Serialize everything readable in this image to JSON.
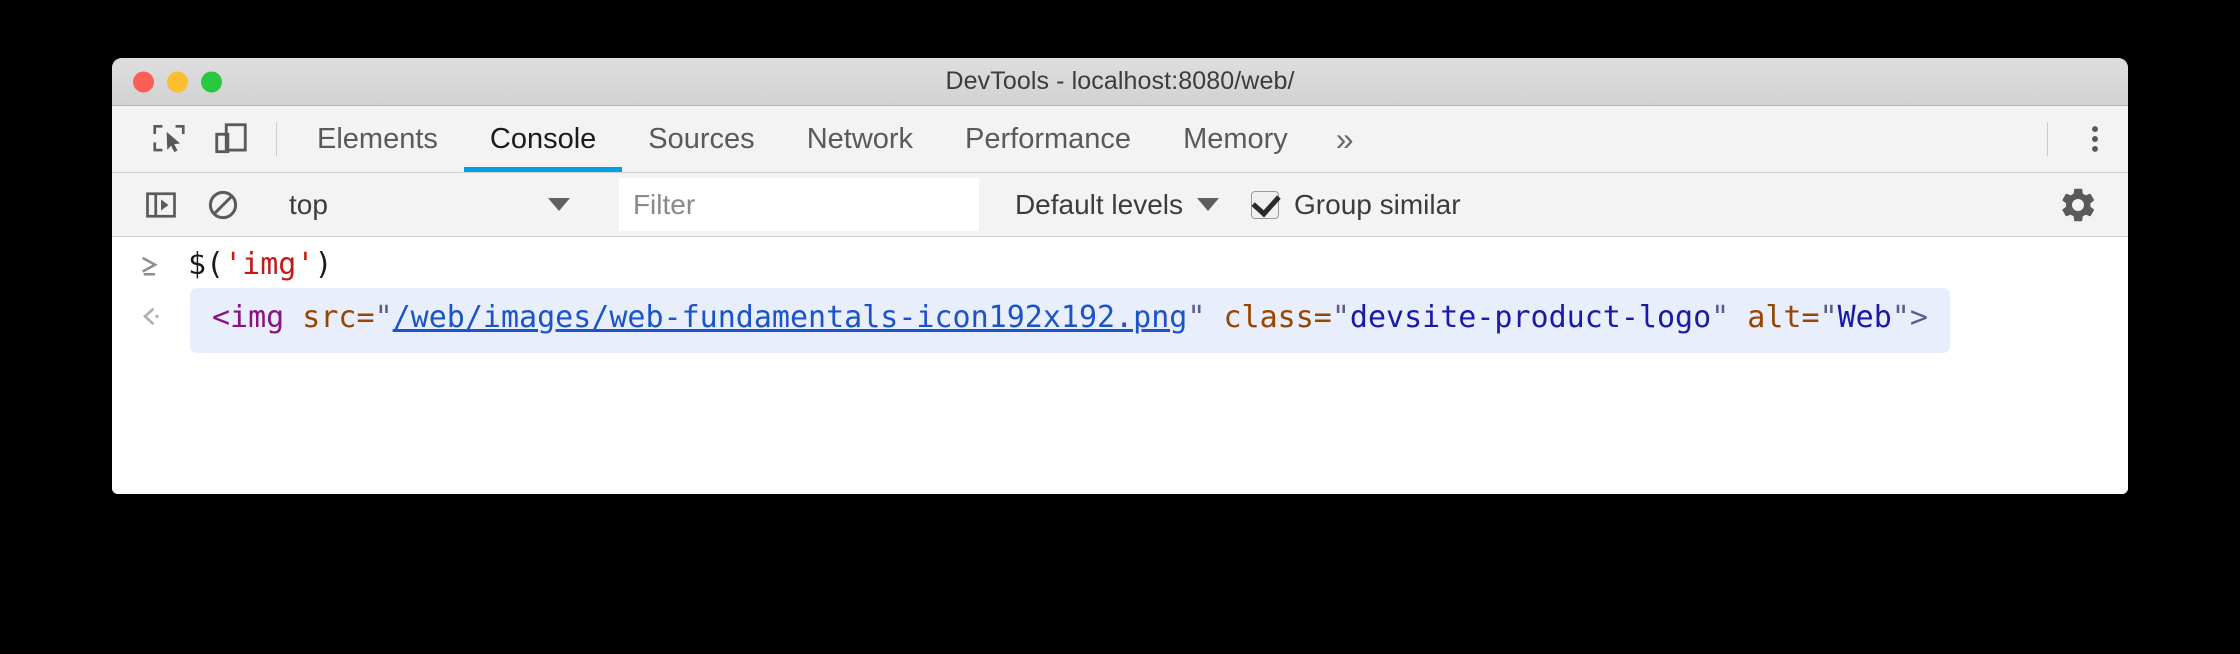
{
  "window": {
    "title": "DevTools - localhost:8080/web/",
    "traffic_lights": [
      "close",
      "minimize",
      "maximize"
    ]
  },
  "colors": {
    "accent": "#00a0e9",
    "titlebar": "#d6d6d6",
    "toolbar": "#f3f3f3",
    "output_highlight": "#e8eefb",
    "link": "#1a54c8",
    "tag": "#881280",
    "attribute": "#994500",
    "value": "#1a1aa6",
    "string": "#c41a16"
  },
  "tabbar": {
    "inspect_icon": "inspect-element-icon",
    "device_icon": "device-toolbar-icon",
    "tabs": [
      {
        "label": "Elements",
        "active": false
      },
      {
        "label": "Console",
        "active": true
      },
      {
        "label": "Sources",
        "active": false
      },
      {
        "label": "Network",
        "active": false
      },
      {
        "label": "Performance",
        "active": false
      },
      {
        "label": "Memory",
        "active": false
      }
    ],
    "more_label": "»",
    "kebab_icon": "more-options-icon"
  },
  "console_toolbar": {
    "sidebar_icon": "console-sidebar-icon",
    "clear_icon": "clear-console-icon",
    "context": "top",
    "context_caret": "▼",
    "filter_placeholder": "Filter",
    "filter_value": "",
    "levels": "Default levels",
    "levels_caret": "▼",
    "group_similar_label": "Group similar",
    "group_similar_checked": true,
    "settings_icon": "settings-gear-icon"
  },
  "console": {
    "input": {
      "prompt": "›",
      "code_prefix": "$(",
      "code_string": "'img'",
      "code_suffix": ")"
    },
    "output": {
      "prompt": "‹",
      "tag_open": "<img",
      "attr_src": " src=",
      "quote": "\"",
      "src_value": "/web/images/web-fundamentals-icon192x192.png",
      "attr_class": " class=",
      "class_value": "devsite-product-logo",
      "attr_alt": " alt=",
      "alt_value": "Web",
      "tag_close": ">"
    }
  }
}
